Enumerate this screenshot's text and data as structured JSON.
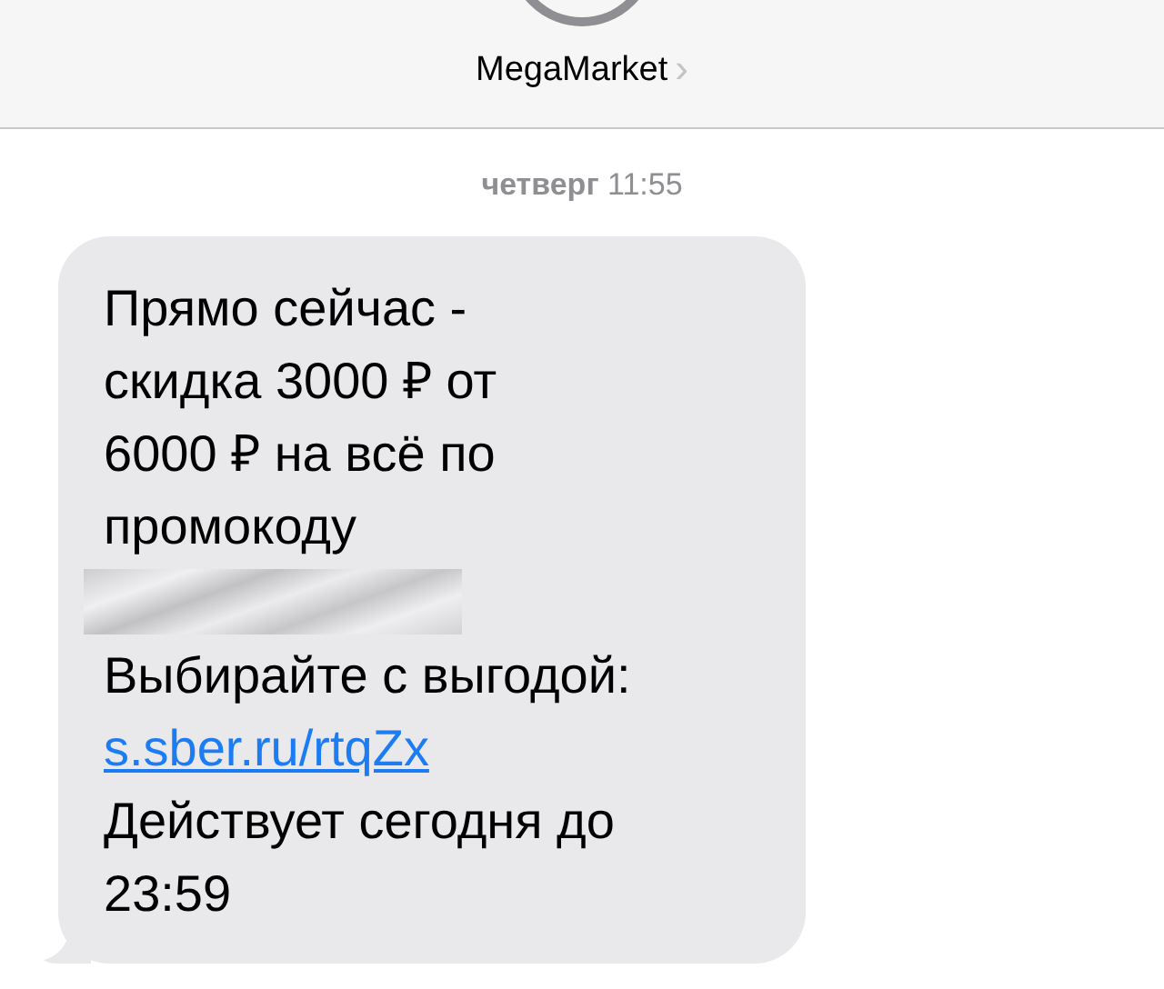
{
  "header": {
    "contact_name": "MegaMarket",
    "chevron": "›"
  },
  "timestamp": {
    "day": "четверг",
    "time": "11:55"
  },
  "message": {
    "before_code": [
      "Прямо сейчас -",
      "скидка 3000 ₽ от",
      "6000 ₽ на всё по",
      "промокоду"
    ],
    "after_code": [
      {
        "kind": "text",
        "text": "Выбирайте с выгодой:"
      },
      {
        "kind": "link",
        "text": "s.sber.ru/rtqZx"
      },
      {
        "kind": "text",
        "text": "Действует сегодня до"
      },
      {
        "kind": "text",
        "text": "23:59"
      }
    ]
  }
}
